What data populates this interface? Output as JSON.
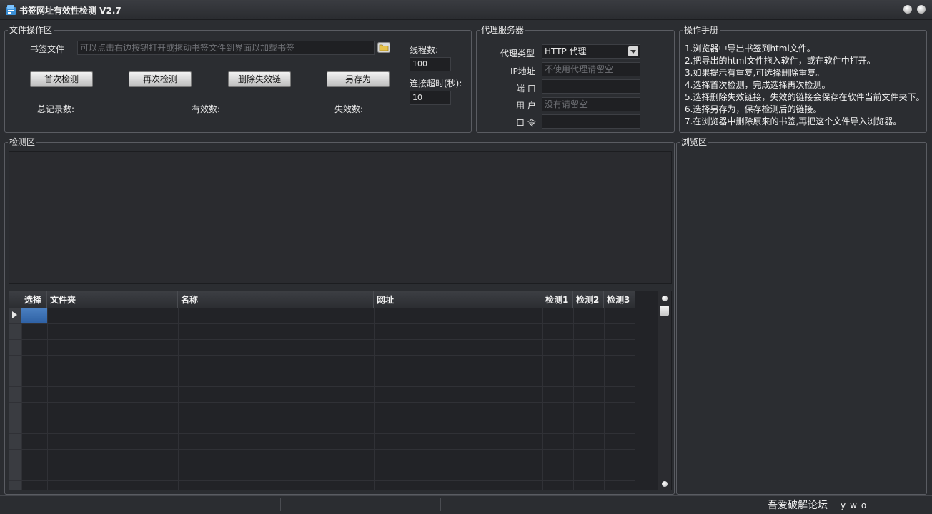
{
  "window": {
    "title": "书签网址有效性检测 V2.7"
  },
  "file_panel": {
    "group_label": "文件操作区",
    "bookmark_label": "书签文件",
    "bookmark_placeholder": "可以点击右边按钮打开或拖动书签文件到界面以加载书签",
    "buttons": [
      "首次检测",
      "再次检测",
      "删除失效链",
      "另存为"
    ],
    "total_label": "总记录数:",
    "valid_label": "有效数:",
    "invalid_label": "失效数:",
    "threads_label": "线程数:",
    "threads_value": "100",
    "timeout_label": "连接超时(秒):",
    "timeout_value": "10"
  },
  "proxy_panel": {
    "group_label": "代理服务器",
    "type_label": "代理类型",
    "type_value": "HTTP 代理",
    "ip_label": "IP地址",
    "ip_placeholder": "不使用代理请留空",
    "port_label": "端 口",
    "user_label": "用 户",
    "user_placeholder": "没有请留空",
    "password_label": "口 令"
  },
  "manual_panel": {
    "group_label": "操作手册",
    "lines": [
      "1.浏览器中导出书签到html文件。",
      "2.把导出的html文件拖入软件，或在软件中打开。",
      "3.如果提示有重复,可选择删除重复。",
      "4.选择首次检测，完成选择再次检测。",
      "5.选择删除失效链接，失效的链接会保存在软件当前文件夹下。",
      "6.选择另存为，保存检测后的链接。",
      "7.在浏览器中删除原来的书签,再把这个文件导入浏览器。"
    ]
  },
  "detect_panel": {
    "group_label": "检测区",
    "columns": [
      "选择",
      "文件夹",
      "名称",
      "网址",
      "检测1",
      "检测2",
      "检测3"
    ]
  },
  "browse_panel": {
    "group_label": "浏览区"
  },
  "statusbar": {
    "forum": "吾爱破解论坛",
    "user": "y_w_o"
  }
}
